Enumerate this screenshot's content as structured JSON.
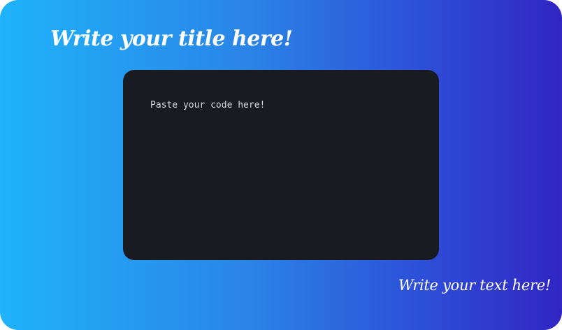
{
  "card": {
    "title": "Write your title here!",
    "code_placeholder": "Paste your code here!",
    "footer_text": "Write your text here!"
  },
  "colors": {
    "gradient_start": "#1fb3fb",
    "gradient_end": "#3125c4",
    "code_background": "#181b22",
    "title_text": "#ffffff",
    "code_text": "#d9dbe0"
  }
}
